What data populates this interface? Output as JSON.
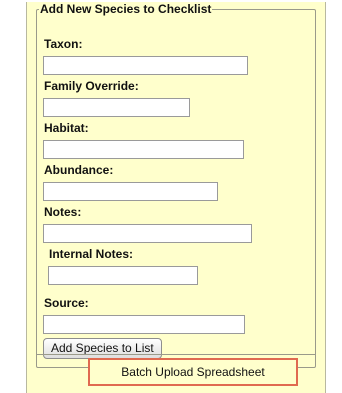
{
  "form": {
    "legend": "Add New Species to Checklist",
    "fields": [
      {
        "label": "Taxon:",
        "value": "",
        "placeholder": ""
      },
      {
        "label": "Family Override:",
        "value": "",
        "placeholder": ""
      },
      {
        "label": "Habitat:",
        "value": "",
        "placeholder": ""
      },
      {
        "label": "Abundance:",
        "value": "",
        "placeholder": ""
      },
      {
        "label": "Notes:",
        "value": "",
        "placeholder": ""
      },
      {
        "label": "Internal Notes:",
        "value": "",
        "placeholder": ""
      },
      {
        "label": "Source:",
        "value": "",
        "placeholder": ""
      }
    ],
    "submit_label": "Add Species to List"
  },
  "batch_upload": {
    "label": "Batch Upload Spreadsheet"
  }
}
